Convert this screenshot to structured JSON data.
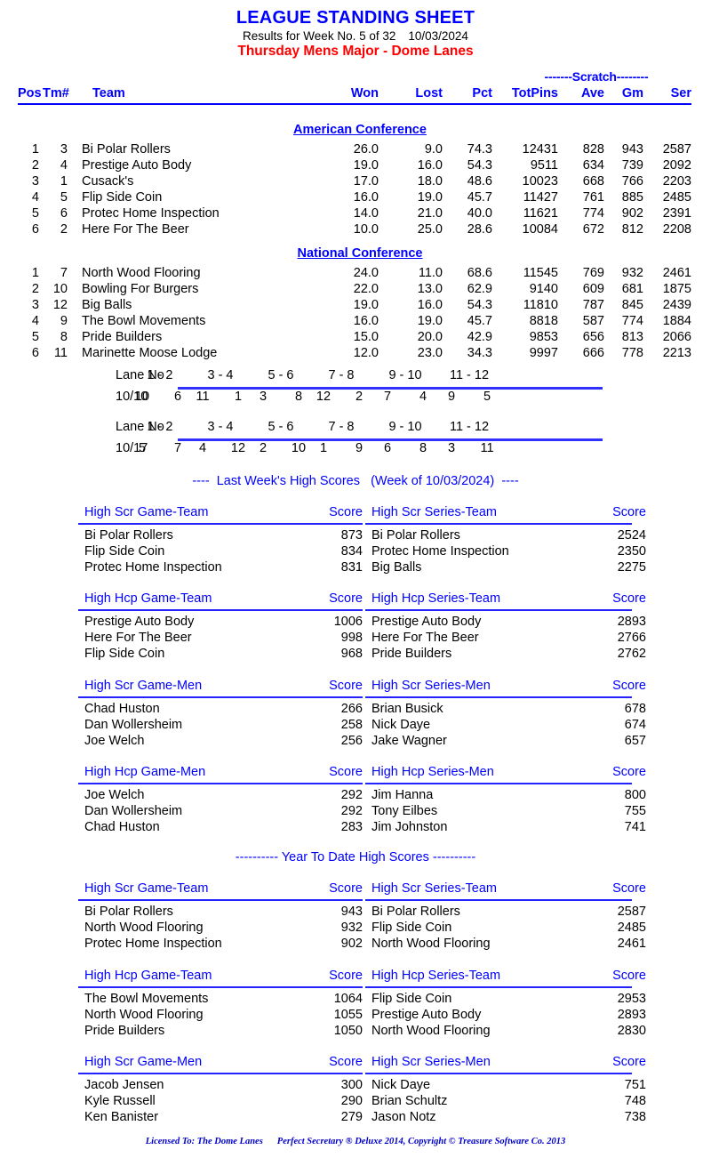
{
  "header": {
    "title": "LEAGUE STANDING SHEET",
    "results_line_a": "Results for Week No. 5 of 32",
    "results_date": "10/03/2024",
    "league_line": "Thursday Mens Major - Dome Lanes",
    "title_color": "#0000ff",
    "league_color": "#ff0000"
  },
  "standings": {
    "scratch_caption": "-------Scratch--------",
    "columns": {
      "pos": "Pos",
      "tm": "Tm#",
      "team": "Team",
      "won": "Won",
      "lost": "Lost",
      "pct": "Pct",
      "totpins": "TotPins",
      "ave": "Ave",
      "gm": "Gm",
      "ser": "Ser"
    },
    "conferences": [
      {
        "name": "American Conference",
        "rows": [
          {
            "pos": "1",
            "tm": "3",
            "team": "Bi Polar Rollers",
            "won": "26.0",
            "lost": "9.0",
            "pct": "74.3",
            "totpins": "12431",
            "ave": "828",
            "gm": "943",
            "ser": "2587"
          },
          {
            "pos": "2",
            "tm": "4",
            "team": "Prestige Auto Body",
            "won": "19.0",
            "lost": "16.0",
            "pct": "54.3",
            "totpins": "9511",
            "ave": "634",
            "gm": "739",
            "ser": "2092"
          },
          {
            "pos": "3",
            "tm": "1",
            "team": "Cusack's",
            "won": "17.0",
            "lost": "18.0",
            "pct": "48.6",
            "totpins": "10023",
            "ave": "668",
            "gm": "766",
            "ser": "2203"
          },
          {
            "pos": "4",
            "tm": "5",
            "team": "Flip Side Coin",
            "won": "16.0",
            "lost": "19.0",
            "pct": "45.7",
            "totpins": "11427",
            "ave": "761",
            "gm": "885",
            "ser": "2485"
          },
          {
            "pos": "5",
            "tm": "6",
            "team": "Protec Home Inspection",
            "won": "14.0",
            "lost": "21.0",
            "pct": "40.0",
            "totpins": "11621",
            "ave": "774",
            "gm": "902",
            "ser": "2391"
          },
          {
            "pos": "6",
            "tm": "2",
            "team": "Here For The Beer",
            "won": "10.0",
            "lost": "25.0",
            "pct": "28.6",
            "totpins": "10084",
            "ave": "672",
            "gm": "812",
            "ser": "2208"
          }
        ]
      },
      {
        "name": "National Conference",
        "rows": [
          {
            "pos": "1",
            "tm": "7",
            "team": "North Wood Flooring",
            "won": "24.0",
            "lost": "11.0",
            "pct": "68.6",
            "totpins": "11545",
            "ave": "769",
            "gm": "932",
            "ser": "2461"
          },
          {
            "pos": "2",
            "tm": "10",
            "team": "Bowling For Burgers",
            "won": "22.0",
            "lost": "13.0",
            "pct": "62.9",
            "totpins": "9140",
            "ave": "609",
            "gm": "681",
            "ser": "1875"
          },
          {
            "pos": "3",
            "tm": "12",
            "team": "Big Balls",
            "won": "19.0",
            "lost": "16.0",
            "pct": "54.3",
            "totpins": "11810",
            "ave": "787",
            "gm": "845",
            "ser": "2439"
          },
          {
            "pos": "4",
            "tm": "9",
            "team": "The Bowl Movements",
            "won": "16.0",
            "lost": "19.0",
            "pct": "45.7",
            "totpins": "8818",
            "ave": "587",
            "gm": "774",
            "ser": "1884"
          },
          {
            "pos": "5",
            "tm": "8",
            "team": "Pride Builders",
            "won": "15.0",
            "lost": "20.0",
            "pct": "42.9",
            "totpins": "9853",
            "ave": "656",
            "gm": "813",
            "ser": "2066"
          },
          {
            "pos": "6",
            "tm": "11",
            "team": "Marinette Moose Lodge",
            "won": "12.0",
            "lost": "23.0",
            "pct": "34.3",
            "totpins": "9997",
            "ave": "666",
            "gm": "778",
            "ser": "2213"
          }
        ]
      }
    ]
  },
  "lane_schedule": {
    "label": "Lane No",
    "lane_pairs": [
      "1 - 2",
      "3 - 4",
      "5 - 6",
      "7 - 8",
      "9 - 10",
      "11 - 12"
    ],
    "weeks": [
      {
        "date": "10/10",
        "teams": [
          "10",
          "6",
          "11",
          "1",
          "3",
          "8",
          "12",
          "2",
          "7",
          "4",
          "9",
          "5"
        ]
      },
      {
        "date": "10/17",
        "teams": [
          "5",
          "7",
          "4",
          "12",
          "2",
          "10",
          "1",
          "9",
          "6",
          "8",
          "3",
          "11"
        ]
      }
    ]
  },
  "last_week": {
    "banner_left": "----",
    "banner_main": "Last Week's High Scores",
    "banner_week": "(Week of 10/03/2024)",
    "banner_right": "----",
    "score_col": "Score",
    "tables": [
      {
        "left_title": "High Scr Game-Team",
        "right_title": "High Scr Series-Team",
        "left": [
          {
            "name": "Bi Polar Rollers",
            "score": "873"
          },
          {
            "name": "Flip Side Coin",
            "score": "834"
          },
          {
            "name": "Protec Home Inspection",
            "score": "831"
          }
        ],
        "right": [
          {
            "name": "Bi Polar Rollers",
            "score": "2524"
          },
          {
            "name": "Protec Home Inspection",
            "score": "2350"
          },
          {
            "name": "Big Balls",
            "score": "2275"
          }
        ]
      },
      {
        "left_title": "High Hcp Game-Team",
        "right_title": "High Hcp Series-Team",
        "left": [
          {
            "name": "Prestige Auto Body",
            "score": "1006"
          },
          {
            "name": "Here For The Beer",
            "score": "998"
          },
          {
            "name": "Flip Side Coin",
            "score": "968"
          }
        ],
        "right": [
          {
            "name": "Prestige Auto Body",
            "score": "2893"
          },
          {
            "name": "Here For The Beer",
            "score": "2766"
          },
          {
            "name": "Pride Builders",
            "score": "2762"
          }
        ]
      },
      {
        "left_title": "High Scr Game-Men",
        "right_title": "High Scr Series-Men",
        "left": [
          {
            "name": "Chad Huston",
            "score": "266"
          },
          {
            "name": "Dan Wollersheim",
            "score": "258"
          },
          {
            "name": "Joe Welch",
            "score": "256"
          }
        ],
        "right": [
          {
            "name": "Brian Busick",
            "score": "678"
          },
          {
            "name": "Nick Daye",
            "score": "674"
          },
          {
            "name": "Jake Wagner",
            "score": "657"
          }
        ]
      },
      {
        "left_title": "High Hcp Game-Men",
        "right_title": "High Hcp Series-Men",
        "left": [
          {
            "name": "Joe Welch",
            "score": "292"
          },
          {
            "name": "Dan Wollersheim",
            "score": "292"
          },
          {
            "name": "Chad Huston",
            "score": "283"
          }
        ],
        "right": [
          {
            "name": "Jim Hanna",
            "score": "800"
          },
          {
            "name": "Tony Eilbes",
            "score": "755"
          },
          {
            "name": "Jim Johnston",
            "score": "741"
          }
        ]
      }
    ]
  },
  "year_to_date": {
    "banner": "---------- Year To Date High Scores ----------",
    "score_col": "Score",
    "tables": [
      {
        "left_title": "High Scr Game-Team",
        "right_title": "High Scr Series-Team",
        "left": [
          {
            "name": "Bi Polar Rollers",
            "score": "943"
          },
          {
            "name": "North Wood Flooring",
            "score": "932"
          },
          {
            "name": "Protec Home Inspection",
            "score": "902"
          }
        ],
        "right": [
          {
            "name": "Bi Polar Rollers",
            "score": "2587"
          },
          {
            "name": "Flip Side Coin",
            "score": "2485"
          },
          {
            "name": "North Wood Flooring",
            "score": "2461"
          }
        ]
      },
      {
        "left_title": "High Hcp Game-Team",
        "right_title": "High Hcp Series-Team",
        "left": [
          {
            "name": "The Bowl Movements",
            "score": "1064"
          },
          {
            "name": "North Wood Flooring",
            "score": "1055"
          },
          {
            "name": "Pride Builders",
            "score": "1050"
          }
        ],
        "right": [
          {
            "name": "Flip Side Coin",
            "score": "2953"
          },
          {
            "name": "Prestige Auto Body",
            "score": "2893"
          },
          {
            "name": "North Wood Flooring",
            "score": "2830"
          }
        ]
      },
      {
        "left_title": "High Scr Game-Men",
        "right_title": "High Scr Series-Men",
        "left": [
          {
            "name": "Jacob Jensen",
            "score": "300"
          },
          {
            "name": "Kyle Russell",
            "score": "290"
          },
          {
            "name": "Ken Banister",
            "score": "279"
          }
        ],
        "right": [
          {
            "name": "Nick Daye",
            "score": "751"
          },
          {
            "name": "Brian Schultz",
            "score": "748"
          },
          {
            "name": "Jason Notz",
            "score": "738"
          }
        ]
      }
    ]
  },
  "footer": {
    "licensed_to": "Licensed To: The Dome Lanes",
    "software": "Perfect Secretary ® Deluxe  2014, Copyright © Treasure Software Co. 2013"
  }
}
